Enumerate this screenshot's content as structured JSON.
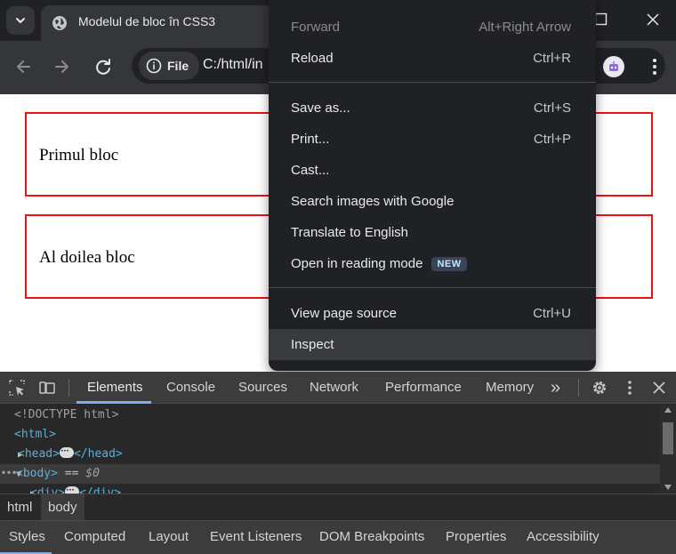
{
  "browser": {
    "tab_title": "Modelul de bloc în CSS3",
    "file_chip": "File",
    "url": "C:/html/in"
  },
  "page": {
    "blocks": [
      "Primul bloc",
      "Al doilea bloc"
    ]
  },
  "context_menu": {
    "items": [
      {
        "label": "Forward",
        "shortcut": "Alt+Right Arrow"
      },
      {
        "label": "Reload",
        "shortcut": "Ctrl+R"
      },
      {
        "label": "Save as...",
        "shortcut": "Ctrl+S"
      },
      {
        "label": "Print...",
        "shortcut": "Ctrl+P"
      },
      {
        "label": "Cast...",
        "shortcut": ""
      },
      {
        "label": "Search images with Google",
        "shortcut": ""
      },
      {
        "label": "Translate to English",
        "shortcut": ""
      },
      {
        "label": "Open in reading mode",
        "shortcut": "",
        "badge": "NEW"
      },
      {
        "label": "View page source",
        "shortcut": "Ctrl+U"
      },
      {
        "label": "Inspect",
        "shortcut": ""
      }
    ]
  },
  "devtools": {
    "tabs": [
      "Elements",
      "Console",
      "Sources",
      "Network",
      "Performance",
      "Memory"
    ],
    "more_tabs": "»",
    "dom": {
      "doctype": "<!DOCTYPE html>",
      "html_open": "<html>",
      "head_open": "<head>",
      "head_close": "</head>",
      "body_open": "<body>",
      "body_eq": "==",
      "body_var": "$0",
      "div_open": "<div>",
      "div_close": "</div>",
      "gutter_dots": "•••"
    },
    "breadcrumbs": [
      "html",
      "body"
    ],
    "subtabs": [
      "Styles",
      "Computed",
      "Layout",
      "Event Listeners",
      "DOM Breakpoints",
      "Properties",
      "Accessibility"
    ]
  },
  "colors": {
    "block_border": "#ee1111",
    "devtools_accent": "#7cacf8",
    "chrome_dark": "#202124"
  }
}
